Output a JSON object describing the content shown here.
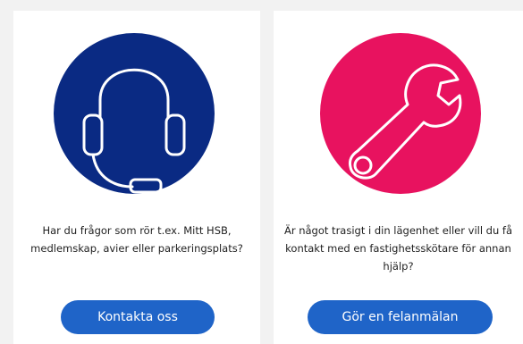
{
  "colors": {
    "support_circle": "#0a2a83",
    "repair_circle": "#e8125f",
    "button": "#1f64c8",
    "icon_stroke": "#ffffff"
  },
  "cards": [
    {
      "icon": "headset-icon",
      "text": "Har du frågor som rör t.ex. Mitt HSB, medlemskap, avier eller parkeringsplats?",
      "button_label": "Kontakta oss"
    },
    {
      "icon": "wrench-icon",
      "text": "Är något trasigt i din lägenhet eller vill du få kontakt med en fastighetsskötare för annan hjälp?",
      "button_label": "Gör en felanmälan"
    }
  ]
}
